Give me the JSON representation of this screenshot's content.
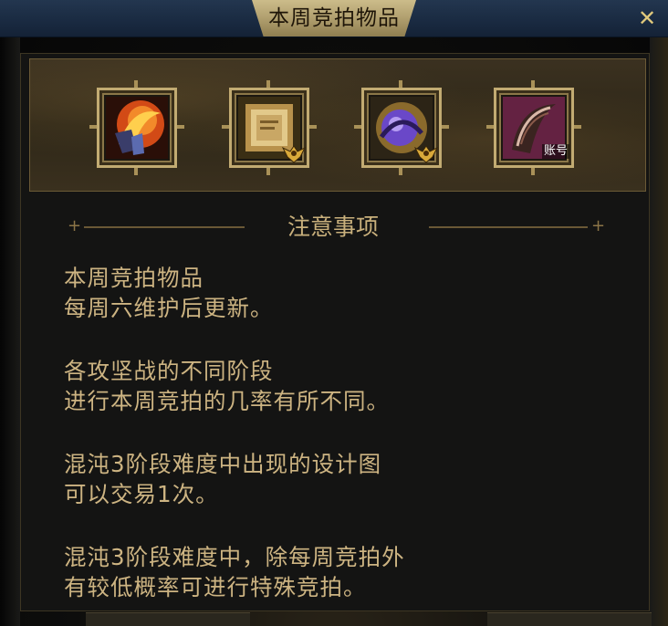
{
  "window": {
    "title": "本周竞拍物品",
    "close_symbol": "✕"
  },
  "items": [
    {
      "icon": "flame-orb-icon",
      "color": "#e0521c"
    },
    {
      "icon": "golden-scroll-icon",
      "color": "#c8a35a",
      "badge": "wing-emblem-icon"
    },
    {
      "icon": "purple-chain-orb-icon",
      "color": "#7a55d6",
      "badge": "wing-emblem-icon"
    },
    {
      "icon": "feather-quill-icon",
      "color": "#b0455a",
      "tag": "账号"
    }
  ],
  "notes": {
    "heading": "注意事项",
    "paragraphs": [
      {
        "line1": "本周竞拍物品",
        "line2": "每周六维护后更新。"
      },
      {
        "line1": "各攻坚战的不同阶段",
        "line2": "进行本周竞拍的几率有所不同。"
      },
      {
        "line1": "混沌3阶段难度中出现的设计图",
        "line2": "可以交易1次。"
      },
      {
        "line1": "混沌3阶段难度中，除每周竞拍外",
        "line2": "有较低概率可进行特殊竞拍。"
      }
    ]
  },
  "colors": {
    "gold_text": "#cdb482",
    "title_bar": "#1a2b42",
    "frame_gold": "#c2ab72"
  }
}
